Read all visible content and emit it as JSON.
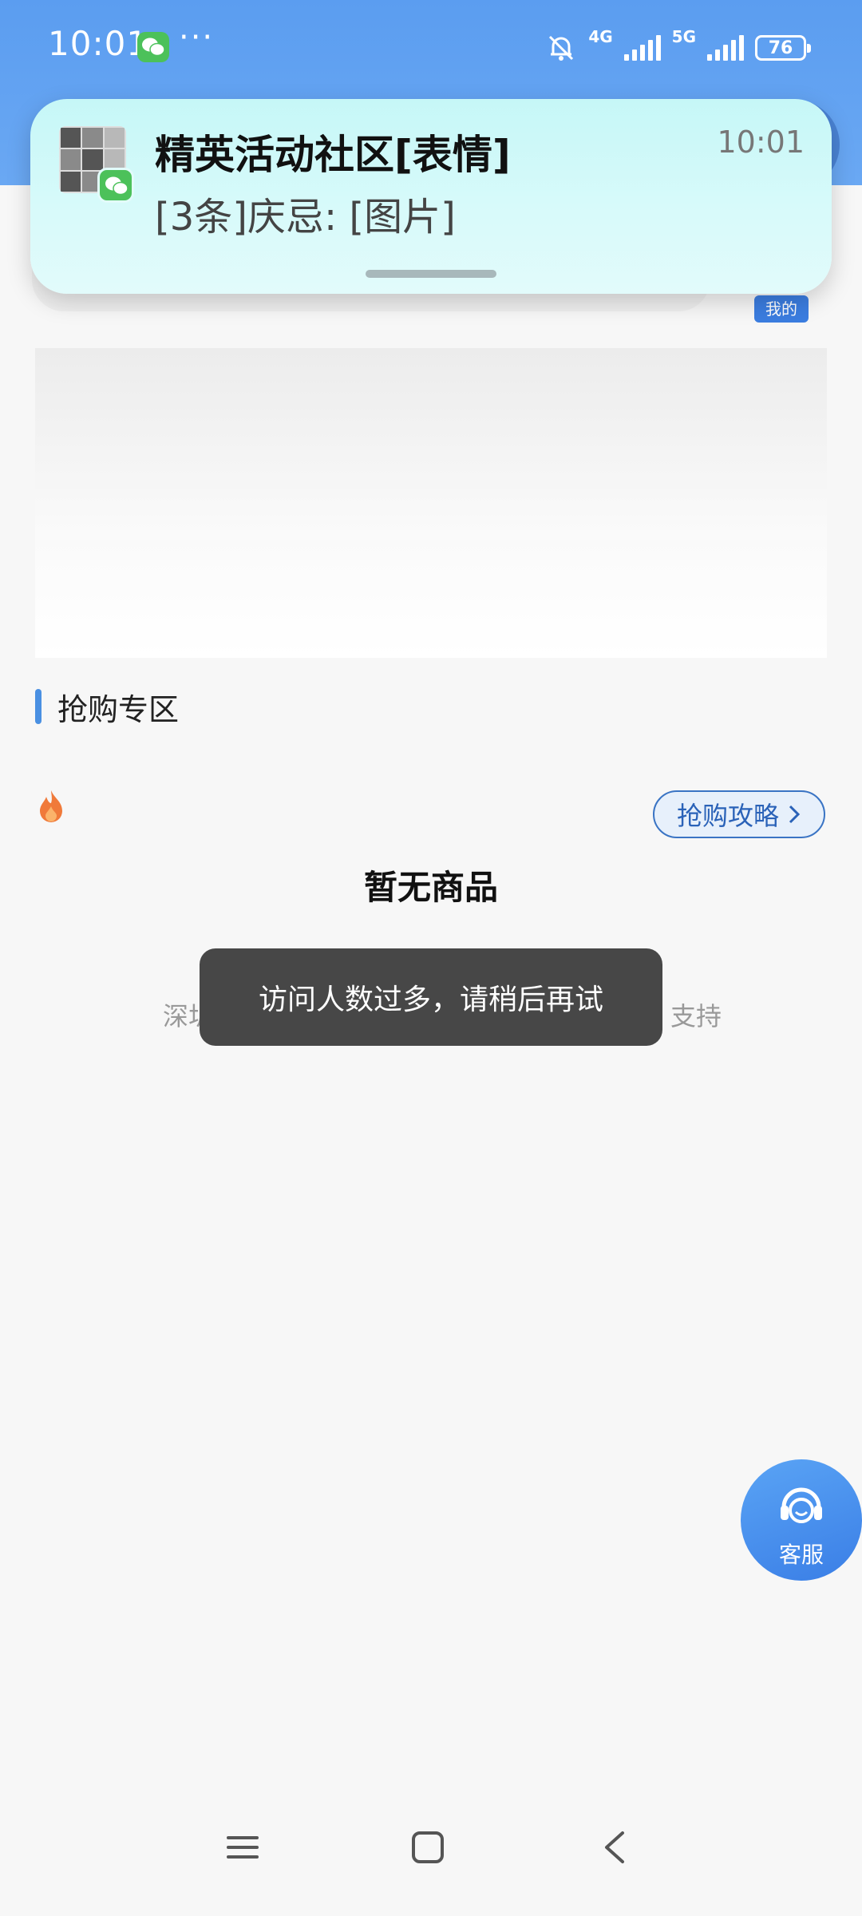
{
  "status_bar": {
    "time": "10:01",
    "dots": "···",
    "net1": "4G",
    "net2": "5G",
    "battery": "76"
  },
  "notification": {
    "title": "精英活动社区[表情]",
    "body": "[3条]庆忌: [图片]",
    "time": "10:01"
  },
  "header": {
    "mine_label": "我的"
  },
  "section": {
    "title": "抢购专区",
    "guide_label": "抢购攻略",
    "empty_title": "暂无商品",
    "caption_left": "深圳",
    "caption_right": "支持"
  },
  "toast": {
    "message": "访问人数过多，请稍后再试"
  },
  "service": {
    "label": "客服"
  },
  "colors": {
    "header": "#5b9df0",
    "accent": "#4a90e2",
    "toast": "#474747",
    "wechat": "#4cc15a"
  }
}
